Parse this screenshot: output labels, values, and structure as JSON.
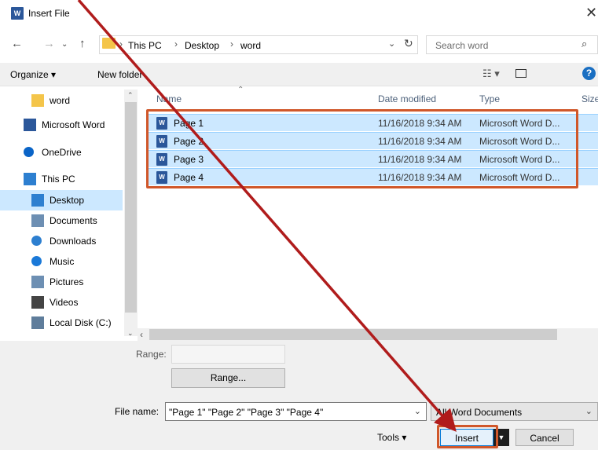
{
  "window": {
    "title": "Insert File",
    "app_icon_text": "W"
  },
  "address": {
    "breadcrumbs": [
      "This PC",
      "Desktop",
      "word"
    ],
    "search_placeholder": "Search word"
  },
  "toolbar": {
    "organize_label": "Organize ▾",
    "new_folder_label": "New folder"
  },
  "nav": {
    "items": [
      {
        "label": "word",
        "icon": "folder-icon",
        "color": "#f4c54a"
      },
      {
        "label": "Microsoft Word",
        "icon": "word-app-icon",
        "color": "#2b579a"
      },
      {
        "label": "OneDrive",
        "icon": "onedrive-icon",
        "color": "#0a64c7"
      },
      {
        "label": "This PC",
        "icon": "computer-icon",
        "color": "#2d7fd0"
      },
      {
        "label": "Desktop",
        "icon": "desktop-icon",
        "color": "#2d7fd0",
        "selected": true
      },
      {
        "label": "Documents",
        "icon": "documents-icon",
        "color": "#6d8fb3"
      },
      {
        "label": "Downloads",
        "icon": "downloads-icon",
        "color": "#2d7fd0"
      },
      {
        "label": "Music",
        "icon": "music-icon",
        "color": "#1a79d8"
      },
      {
        "label": "Pictures",
        "icon": "pictures-icon",
        "color": "#6d8fb3"
      },
      {
        "label": "Videos",
        "icon": "videos-icon",
        "color": "#444444"
      },
      {
        "label": "Local Disk (C:)",
        "icon": "disk-icon",
        "color": "#5f7d9b"
      }
    ]
  },
  "files": {
    "columns": [
      "Name",
      "Date modified",
      "Type",
      "Size"
    ],
    "rows": [
      {
        "name": "Page 1",
        "date": "11/16/2018 9:34 AM",
        "type": "Microsoft Word D..."
      },
      {
        "name": "Page 2",
        "date": "11/16/2018 9:34 AM",
        "type": "Microsoft Word D..."
      },
      {
        "name": "Page 3",
        "date": "11/16/2018 9:34 AM",
        "type": "Microsoft Word D..."
      },
      {
        "name": "Page 4",
        "date": "11/16/2018 9:34 AM",
        "type": "Microsoft Word D..."
      }
    ]
  },
  "bottom": {
    "range_label": "Range:",
    "range_button": "Range...",
    "file_name_label": "File name:",
    "file_name_value": "\"Page 1\" \"Page 2\" \"Page 3\" \"Page 4\"",
    "file_type_value": "All Word Documents",
    "tools_label": "Tools ▾",
    "insert_label": "Insert",
    "cancel_label": "Cancel"
  },
  "annotation": {
    "arrow_color": "#b01c1c",
    "highlight_color": "#d0572a"
  }
}
